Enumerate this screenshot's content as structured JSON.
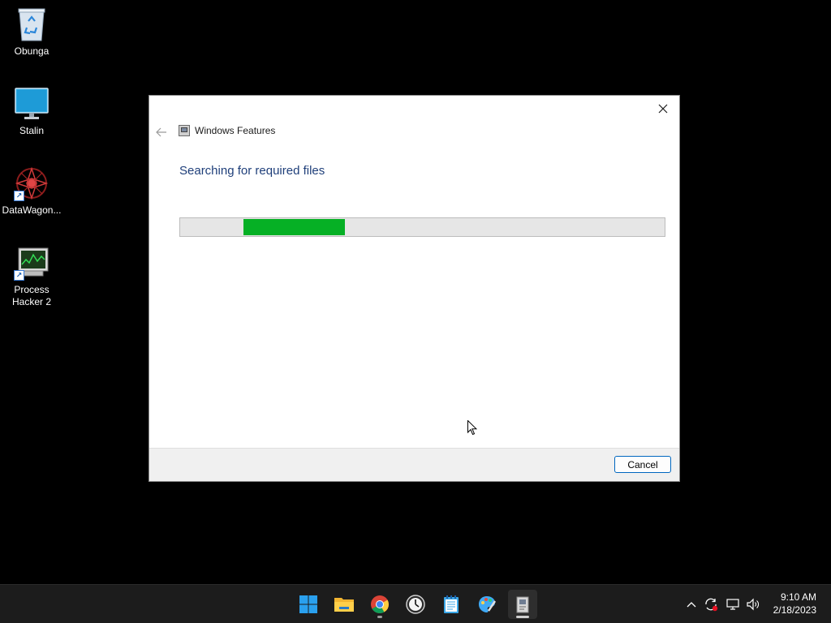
{
  "desktop": {
    "icons": [
      {
        "label": "Obunga"
      },
      {
        "label": "Stalin"
      },
      {
        "label": "DataWagon..."
      },
      {
        "label": "Process Hacker 2"
      }
    ]
  },
  "dialog": {
    "title": "Windows Features",
    "heading": "Searching for required files",
    "progress": {
      "state": "indeterminate",
      "segment_start_fraction": 0.13,
      "segment_end_fraction": 0.34
    },
    "cancel_label": "Cancel",
    "accent_color": "#06b025"
  },
  "taskbar": {
    "apps": [
      {
        "icon": "windows-start-icon"
      },
      {
        "icon": "file-explorer-icon"
      },
      {
        "icon": "chrome-icon"
      },
      {
        "icon": "clock-app-icon"
      },
      {
        "icon": "notepad-icon"
      },
      {
        "icon": "paint-icon"
      },
      {
        "icon": "windows-features-icon"
      }
    ],
    "tray": [
      "chevron-up-icon",
      "sync-icon",
      "network-icon",
      "volume-icon"
    ],
    "time": "9:10 AM",
    "date": "2/18/2023"
  }
}
